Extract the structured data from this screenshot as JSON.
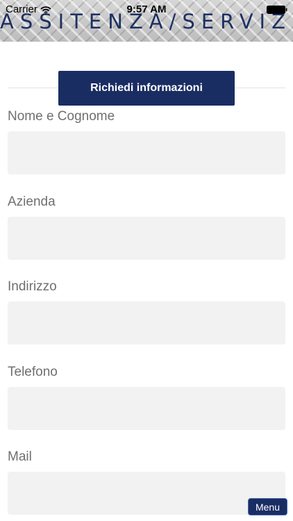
{
  "status_bar": {
    "carrier": "Carrier",
    "time": "9:57 AM"
  },
  "header": {
    "title": "ASSITENZA/SERVIZI"
  },
  "request_button": {
    "label": "Richiedi informazioni"
  },
  "form": {
    "fields": [
      {
        "label": "Nome e Cognome",
        "value": ""
      },
      {
        "label": "Azienda",
        "value": ""
      },
      {
        "label": "Indirizzo",
        "value": ""
      },
      {
        "label": "Telefono",
        "value": ""
      },
      {
        "label": "Mail",
        "value": ""
      }
    ]
  },
  "menu_button": {
    "label": "Menu"
  },
  "colors": {
    "primary": "#1a2d63",
    "field_background": "#f2f2f2",
    "label_text": "#6f6f6f"
  },
  "icons": {
    "wifi": "wifi-icon",
    "battery": "battery-icon"
  }
}
